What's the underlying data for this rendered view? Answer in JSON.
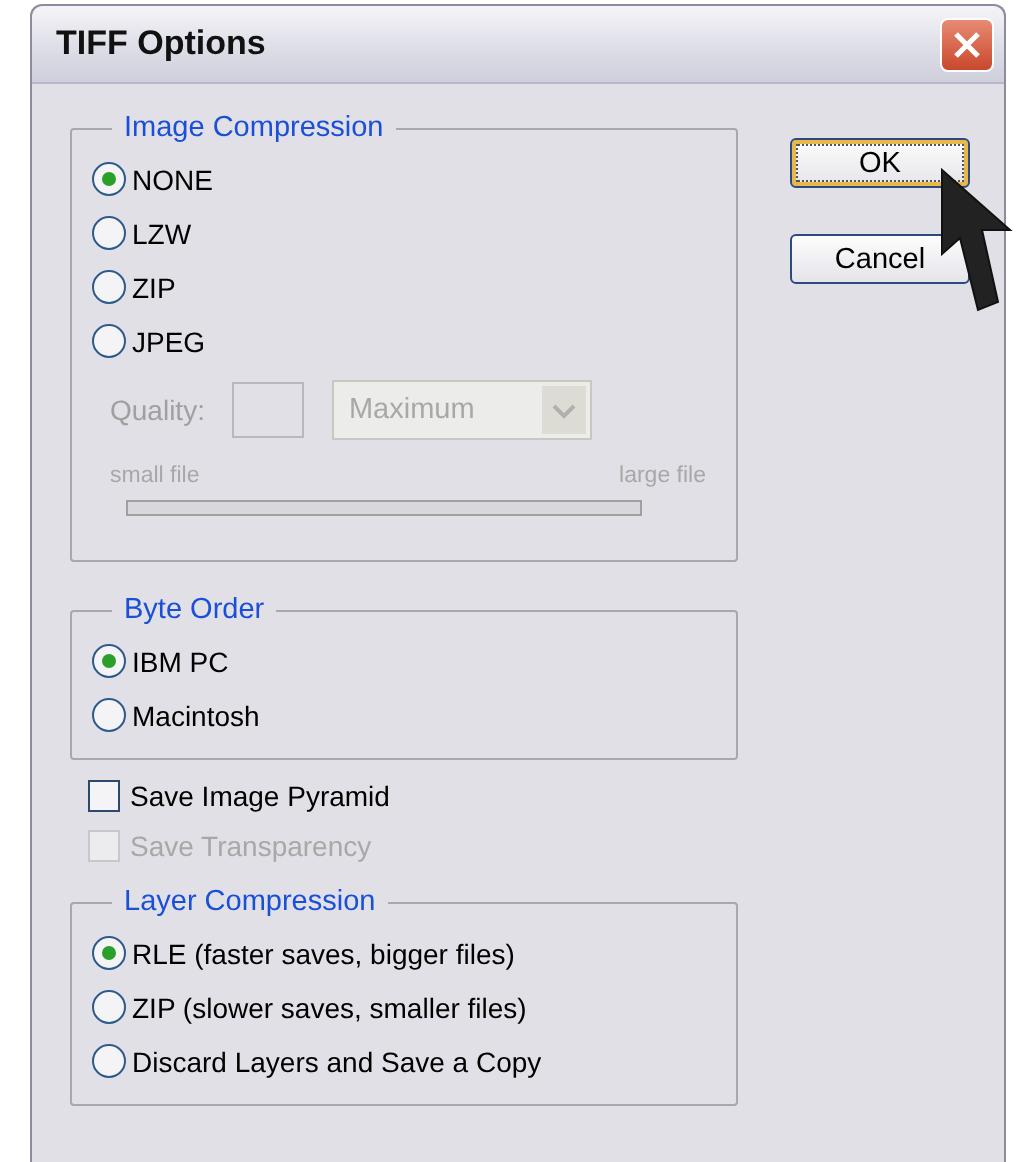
{
  "window": {
    "title": "TIFF Options"
  },
  "image_compression": {
    "title": "Image Compression",
    "options": [
      {
        "label": "NONE",
        "selected": true
      },
      {
        "label": "LZW",
        "selected": false
      },
      {
        "label": "ZIP",
        "selected": false
      },
      {
        "label": "JPEG",
        "selected": false
      }
    ],
    "quality": {
      "disabled": true,
      "label": "Quality:",
      "preset": "Maximum",
      "min_label": "small file",
      "max_label": "large file"
    }
  },
  "byte_order": {
    "title": "Byte Order",
    "options": [
      {
        "label": "IBM PC",
        "selected": true
      },
      {
        "label": "Macintosh",
        "selected": false
      }
    ]
  },
  "checkboxes": [
    {
      "label": "Save Image Pyramid",
      "checked": false,
      "disabled": false
    },
    {
      "label": "Save Transparency",
      "checked": false,
      "disabled": true
    }
  ],
  "layer_compression": {
    "title": "Layer Compression",
    "options": [
      {
        "label": "RLE (faster saves, bigger files)",
        "selected": true
      },
      {
        "label": "ZIP (slower saves, smaller files)",
        "selected": false
      },
      {
        "label": "Discard Layers and Save a Copy",
        "selected": false
      }
    ]
  },
  "buttons": [
    {
      "label": "OK",
      "default": true
    },
    {
      "label": "Cancel",
      "default": false
    }
  ]
}
